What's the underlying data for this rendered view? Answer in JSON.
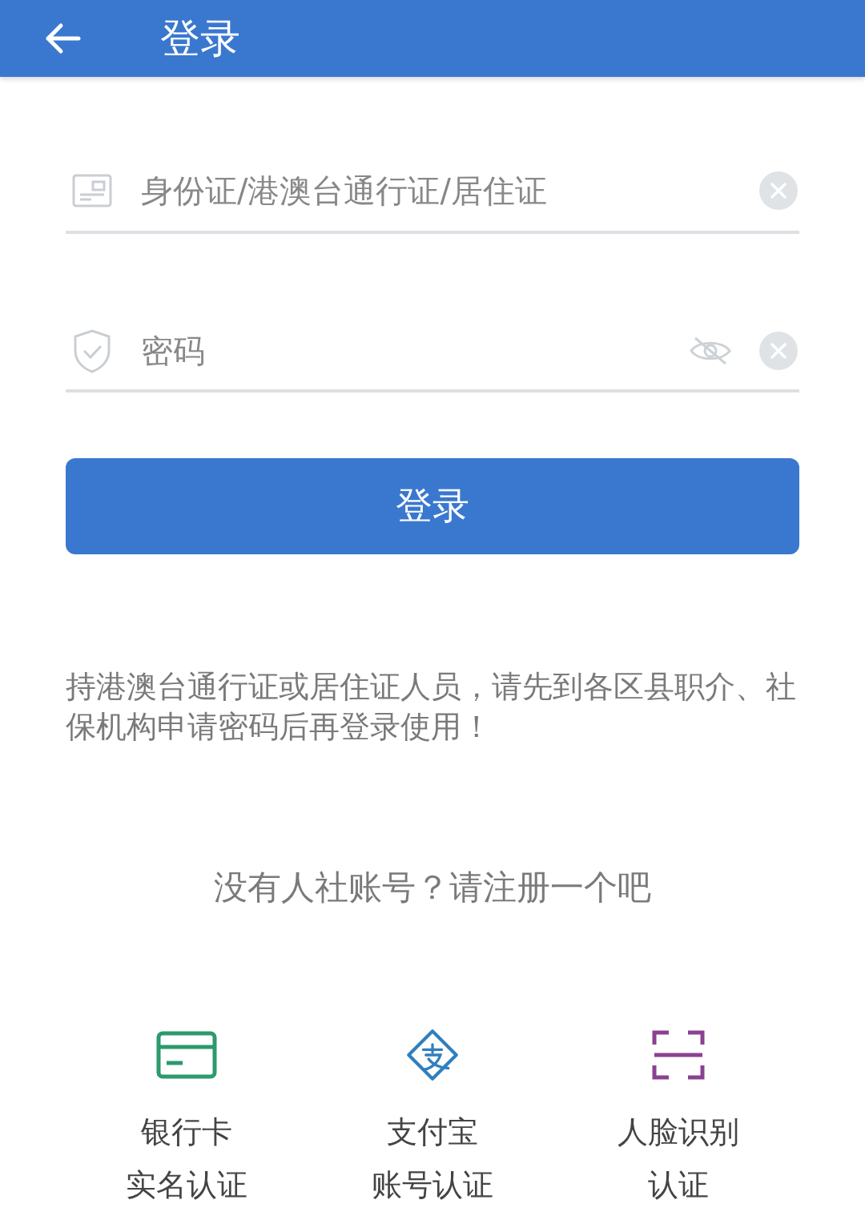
{
  "header": {
    "title": "登录"
  },
  "fields": [
    {
      "kind": "account",
      "placeholder": "身份证/港澳台通行证/居住证"
    },
    {
      "kind": "password",
      "placeholder": "密码",
      "masked": true
    }
  ],
  "login_button": "登录",
  "notice": "持港澳台通行证或居住证人员，请先到各区县职介、社保机构申请密码后再登录使用！",
  "register_prompt": "没有人社账号？请注册一个吧",
  "options": [
    {
      "kind": "bank-card",
      "label": "银行卡",
      "sublabel": "实名认证",
      "color": "#2b9a6c"
    },
    {
      "kind": "alipay",
      "label": "支付宝",
      "sublabel": "账号认证",
      "color": "#2f7fbf"
    },
    {
      "kind": "face",
      "label": "人脸识别",
      "sublabel": "认证",
      "color": "#8b4191"
    }
  ]
}
